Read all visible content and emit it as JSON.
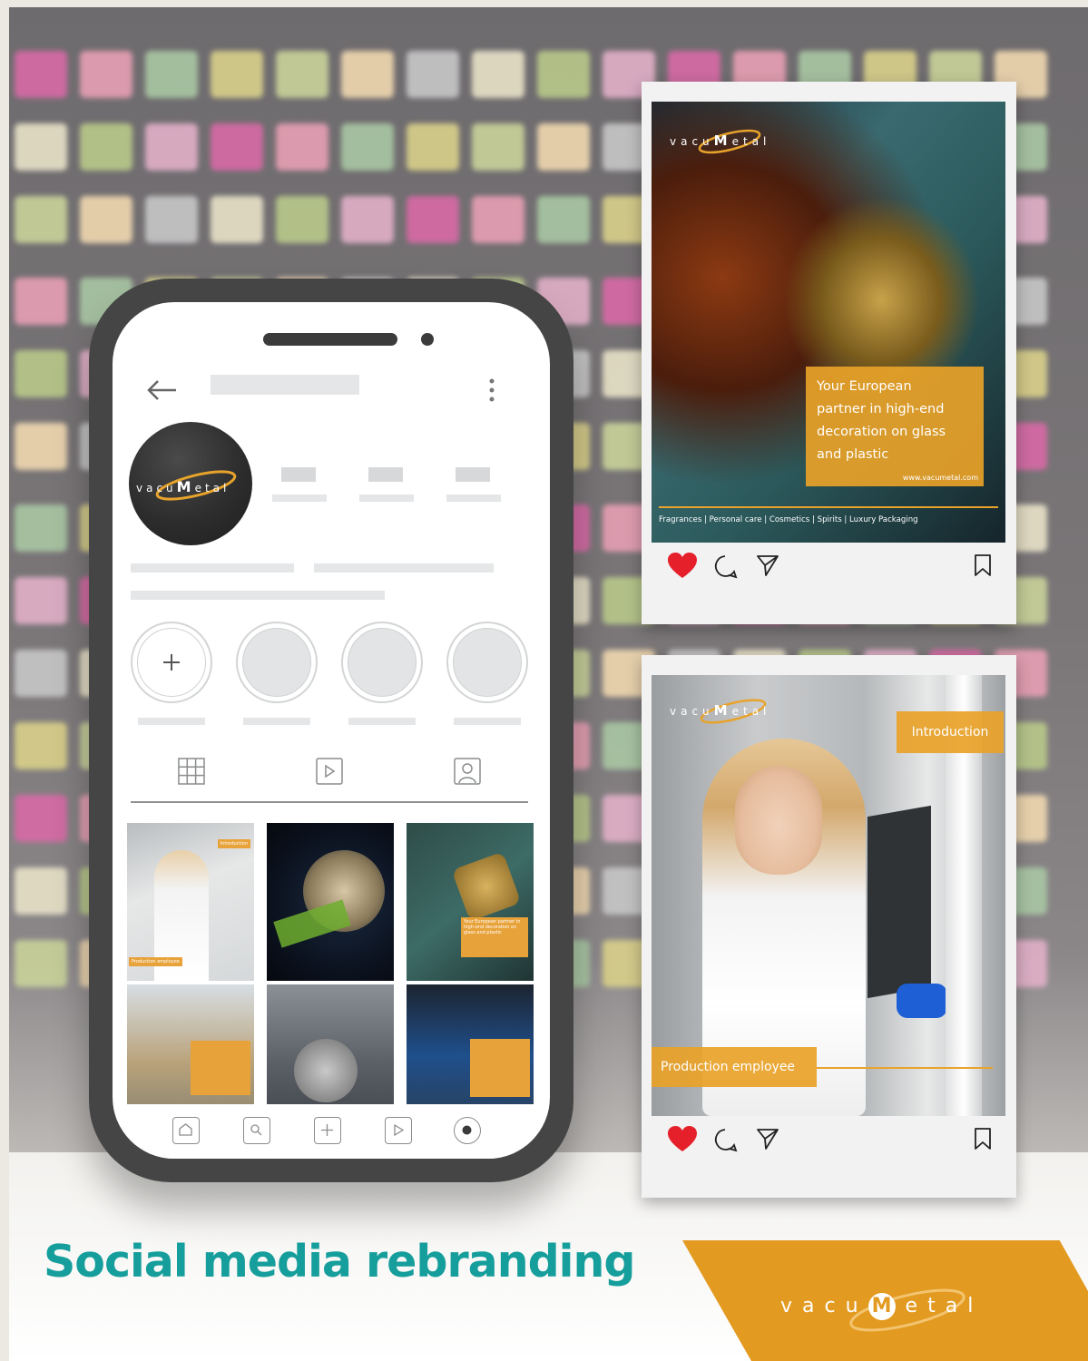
{
  "brand": {
    "logo_text": "vacuMetal",
    "logo_prefix": "vacu",
    "logo_m": "M",
    "logo_suffix": "etal",
    "accent_orange": "#e39a20",
    "headline_teal": "#159e9b"
  },
  "headline": "Social media rebranding",
  "phone": {
    "profile_nav": {
      "back_icon": "arrow-left-icon",
      "menu_icon": "more-vertical-icon"
    },
    "stories": {
      "add_icon": "plus-icon",
      "placeholder_count": 3
    },
    "tabs": [
      "grid-icon",
      "reels-icon",
      "tagged-user-icon"
    ],
    "grid_posts": [
      {
        "label": "Introduction",
        "caption": "Production employee"
      },
      {
        "label": ""
      },
      {
        "caption": "Your European partner in high-end decoration on glass and plastic"
      },
      {
        "caption": ""
      },
      {
        "caption": ""
      },
      {
        "caption": ""
      }
    ],
    "bottom_nav": [
      "home-icon",
      "search-icon",
      "add-icon",
      "reels-icon",
      "profile-icon"
    ]
  },
  "post_1": {
    "overlay_text": "Your European partner in high-end decoration on glass and plastic",
    "overlay_line1": "Your European",
    "overlay_line2": "partner in high-end",
    "overlay_line3": "decoration on glass",
    "overlay_line4": "and plastic",
    "url": "www.vacumetal.com",
    "categories": "Fragrances | Personal care | Cosmetics | Spirits | Luxury Packaging",
    "liked": true
  },
  "post_2": {
    "tag": "Introduction",
    "caption": "Production employee",
    "liked": true
  }
}
